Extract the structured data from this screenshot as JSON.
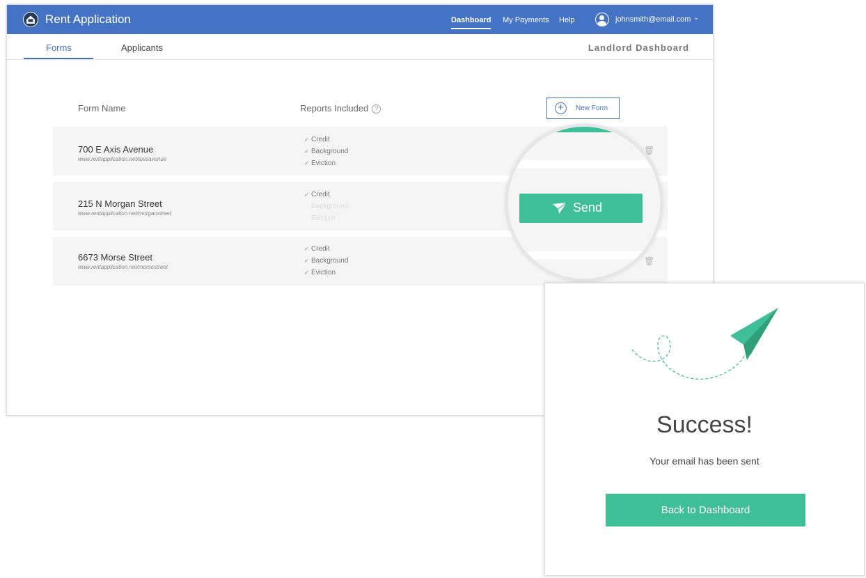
{
  "app": {
    "title": "Rent Application"
  },
  "nav": {
    "dashboard": "Dashboard",
    "payments": "My Payments",
    "help": "Help",
    "user_email": "johnsmith@email.com"
  },
  "tabs": {
    "forms": "Forms",
    "applicants": "Applicants",
    "section_title": "Landlord Dashboard"
  },
  "table": {
    "col_form_name": "Form Name",
    "col_reports": "Reports Included",
    "help_glyph": "?",
    "new_form_label": "New Form",
    "rows": [
      {
        "name": "700 E Axis Avenue",
        "url": "www.rentapplication.net/axisavenue",
        "reports": [
          {
            "label": "Credit",
            "included": true
          },
          {
            "label": "Background",
            "included": true
          },
          {
            "label": "Eviction",
            "included": true
          }
        ]
      },
      {
        "name": "215 N Morgan Street",
        "url": "www.rentapplication.net/morganstreet",
        "reports": [
          {
            "label": "Credit",
            "included": true
          },
          {
            "label": "Background",
            "included": false
          },
          {
            "label": "Eviction",
            "included": false
          }
        ]
      },
      {
        "name": "6673 Morse Street",
        "url": "www.rentapplication.net/morsestreet",
        "reports": [
          {
            "label": "Credit",
            "included": true
          },
          {
            "label": "Background",
            "included": true
          },
          {
            "label": "Eviction",
            "included": true
          }
        ]
      }
    ]
  },
  "magnifier": {
    "send_label": "Send"
  },
  "success": {
    "title": "Success!",
    "message": "Your email has been sent",
    "back_label": "Back to Dashboard"
  },
  "colors": {
    "brand_blue": "#4472c4",
    "accent_green": "#3fbf95"
  },
  "icons": [
    "logo-icon",
    "user-icon",
    "chevron-down-icon",
    "help-icon",
    "plus-circle-icon",
    "trash-icon",
    "paper-plane-icon"
  ]
}
